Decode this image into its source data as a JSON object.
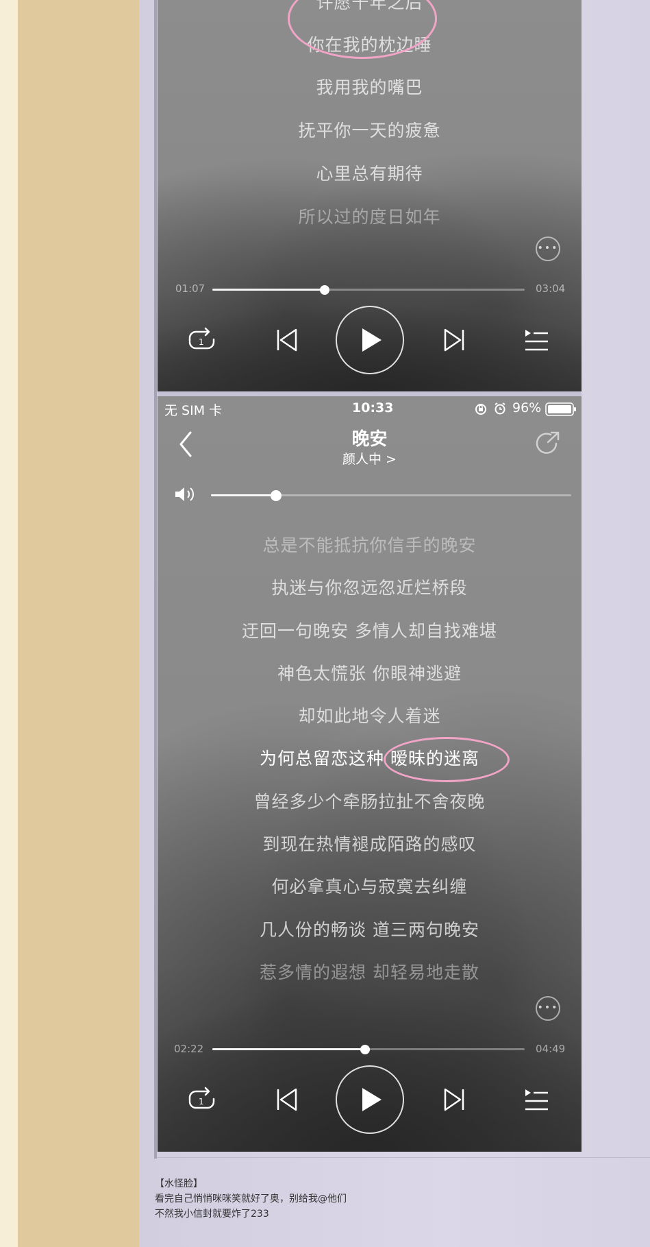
{
  "screenshot1": {
    "lyrics": [
      "许愿千年之后",
      "你在我的枕边睡",
      "我用我的嘴巴",
      "抚平你一天的疲惫",
      "心里总有期待",
      "所以过的度日如年"
    ],
    "elapsed": "01:07",
    "duration": "03:04",
    "progress_fraction": 0.36
  },
  "screenshot2": {
    "status": {
      "carrier": "无 SIM 卡",
      "time": "10:33",
      "battery": "96%"
    },
    "song_title": "晚安",
    "artist": "颜人中 >",
    "volume_fraction": 0.18,
    "lyrics": [
      "总是不能抵抗你信手的晚安",
      "执迷与你忽远忽近烂桥段",
      "迂回一句晚安 多情人却自找难堪",
      "神色太慌张 你眼神逃避",
      "却如此地令人着迷",
      "为何总留恋这种 暧昧的迷离",
      "曾经多少个牵肠拉扯不舍夜晚",
      "到现在热情褪成陌路的感叹",
      "何必拿真心与寂寞去纠缠",
      "几人份的畅谈 道三两句晚安",
      "惹多情的遐想 却轻易地走散"
    ],
    "elapsed": "02:22",
    "duration": "04:49",
    "progress_fraction": 0.49
  },
  "comment": {
    "author": "【水怪脸】",
    "line1": "看完自己悄悄咪咪笑就好了奥，别给我@他们",
    "line2": "不然我小信封就要炸了233"
  },
  "icons": [
    "repeat-one-icon",
    "previous-icon",
    "play-icon",
    "next-icon",
    "playlist-icon",
    "more-icon",
    "back-icon",
    "share-icon",
    "volume-icon",
    "battery-icon",
    "alarm-icon",
    "rotation-lock-icon"
  ],
  "colors": {
    "highlight_circle": "#f0a4c6",
    "side_column": "#e0c99c",
    "page_background": "#d8d4e4"
  }
}
